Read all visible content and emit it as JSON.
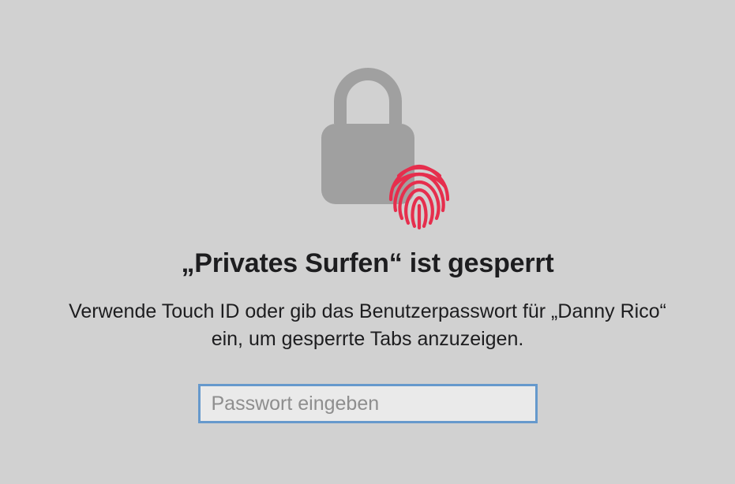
{
  "dialog": {
    "title": "„Privates Surfen“ ist gesperrt",
    "subtitle": "Verwende Touch ID oder gib das Benutzerpasswort für „Danny Rico“ ein, um gesperrte Tabs anzuzeigen.",
    "password_placeholder": "Passwort eingeben",
    "icons": {
      "lock": "lock-icon",
      "fingerprint": "fingerprint-icon"
    },
    "colors": {
      "lock": "#a0a0a0",
      "fingerprint": "#e62e4d",
      "focus_ring": "#6699cc"
    }
  }
}
